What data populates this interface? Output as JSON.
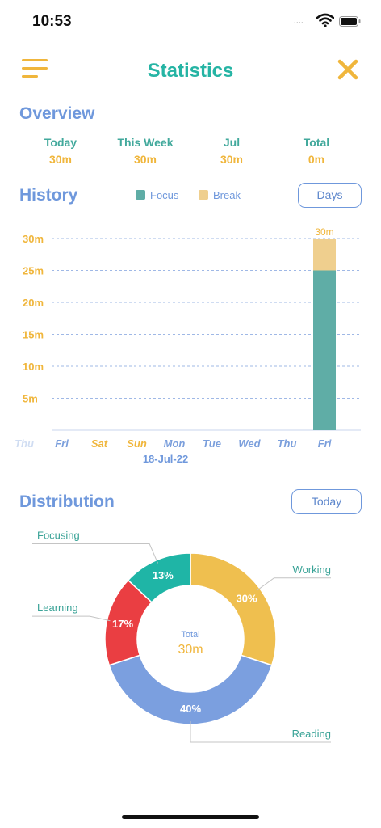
{
  "status_bar": {
    "time": "10:53",
    "signal": "....",
    "icons": [
      "wifi-icon",
      "battery-icon"
    ]
  },
  "nav": {
    "title": "Statistics",
    "left_icon": "menu-icon",
    "right_icon": "close-icon"
  },
  "overview": {
    "title": "Overview",
    "items": [
      {
        "label": "Today",
        "value": "30m"
      },
      {
        "label": "This Week",
        "value": "30m"
      },
      {
        "label": "Jul",
        "value": "30m"
      },
      {
        "label": "Total",
        "value": "0m"
      }
    ]
  },
  "history": {
    "title": "History",
    "legend": [
      {
        "label": "Focus",
        "color": "#5fada6"
      },
      {
        "label": "Break",
        "color": "#efcf8e"
      }
    ],
    "range_button": "Days",
    "date_label": "18-Jul-22"
  },
  "distribution": {
    "title": "Distribution",
    "range_button": "Today",
    "center_label": "Total",
    "center_value": "30m"
  },
  "chart_data": [
    {
      "type": "bar",
      "stacked": true,
      "categories": [
        "Thu",
        "Fri",
        "Sat",
        "Sun",
        "Mon",
        "Tue",
        "Wed",
        "Thu",
        "Fri"
      ],
      "category_colors": [
        "#7b9fdc",
        "#7b9fdc",
        "#f0b63c",
        "#f0b63c",
        "#7b9fdc",
        "#7b9fdc",
        "#7b9fdc",
        "#7b9fdc",
        "#7b9fdc"
      ],
      "series": [
        {
          "name": "Focus",
          "values": [
            0,
            0,
            0,
            0,
            0,
            0,
            0,
            0,
            25
          ],
          "color": "#5fada6"
        },
        {
          "name": "Break",
          "values": [
            0,
            0,
            0,
            0,
            0,
            0,
            0,
            0,
            5
          ],
          "color": "#efcf8e"
        }
      ],
      "bar_total_labels": [
        "",
        "",
        "",
        "",
        "",
        "",
        "",
        "",
        "30m"
      ],
      "yticks": [
        5,
        10,
        15,
        20,
        25,
        30
      ],
      "ytick_labels": [
        "5m",
        "10m",
        "15m",
        "20m",
        "25m",
        "30m"
      ],
      "ylim": [
        0,
        30
      ],
      "grid": true
    },
    {
      "type": "pie",
      "donut": true,
      "slices": [
        {
          "label": "Working",
          "value": 30,
          "pct_label": "30%",
          "color": "#efbf4f"
        },
        {
          "label": "Reading",
          "value": 40,
          "pct_label": "40%",
          "color": "#7b9fdf"
        },
        {
          "label": "Learning",
          "value": 17,
          "pct_label": "17%",
          "color": "#ea3e42"
        },
        {
          "label": "Focusing",
          "value": 13,
          "pct_label": "13%",
          "color": "#1fb5a6"
        }
      ]
    }
  ]
}
